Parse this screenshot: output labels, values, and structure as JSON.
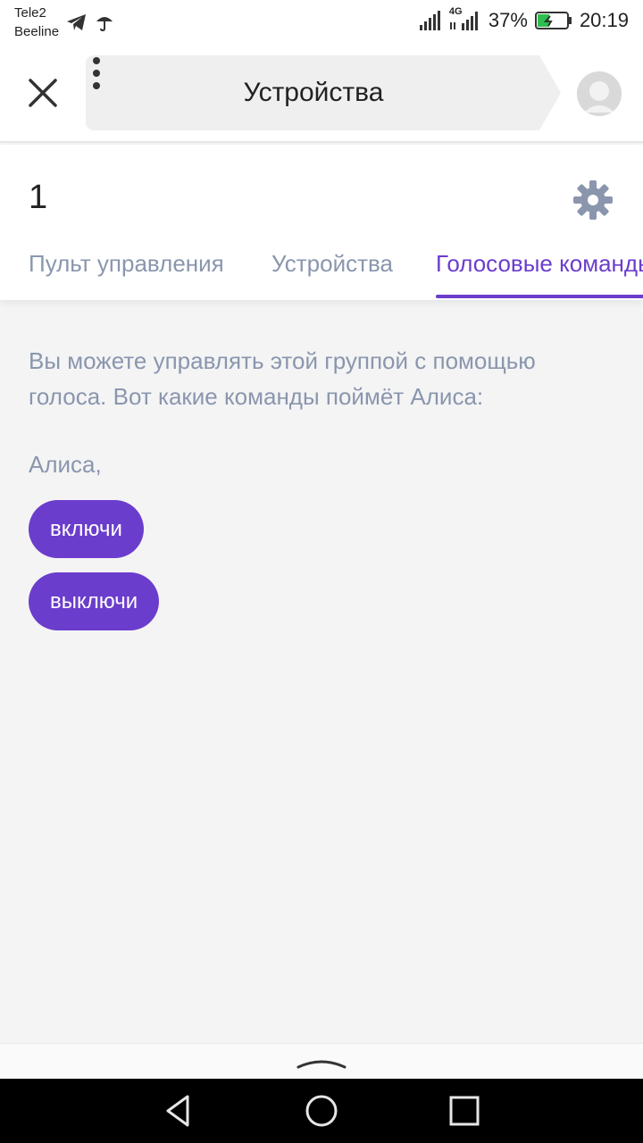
{
  "status_bar": {
    "carrier_1": "Tele2",
    "carrier_2": "Beeline",
    "network": "4G",
    "battery": "37%",
    "time": "20:19"
  },
  "header": {
    "title": "Устройства"
  },
  "group": {
    "name": "1",
    "tabs": [
      {
        "label": "Пульт управления",
        "active": false
      },
      {
        "label": "Устройства",
        "active": false
      },
      {
        "label": "Голосовые команды",
        "active": true
      }
    ]
  },
  "content": {
    "description": "Вы можете управлять этой группой с помощью голоса. Вот какие команды поймёт Алиса:",
    "alice_prefix": "Алиса,",
    "commands": [
      "включи",
      "выключи"
    ]
  },
  "colors": {
    "accent": "#6b3dcc",
    "muted_text": "#8a96ad",
    "background": "#f4f4f5"
  },
  "icons": {
    "close": "close-icon",
    "more": "more-vertical-icon",
    "settings": "gear-icon",
    "avatar": "user-avatar-icon"
  }
}
